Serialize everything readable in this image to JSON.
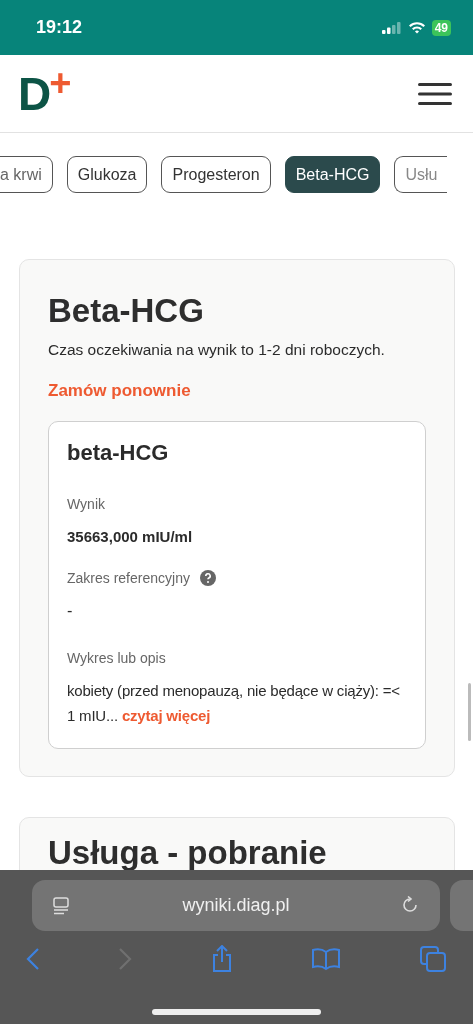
{
  "status_bar": {
    "time": "19:12",
    "battery": "49"
  },
  "header": {
    "logo_letter": "D",
    "logo_mark": "+"
  },
  "chips": [
    {
      "label": "a krwi",
      "selected": false
    },
    {
      "label": "Glukoza",
      "selected": false
    },
    {
      "label": "Progesteron",
      "selected": false
    },
    {
      "label": "Beta-HCG",
      "selected": true
    },
    {
      "label": "Usłu",
      "selected": false
    }
  ],
  "test_card": {
    "title": "Beta-HCG",
    "wait_note": "Czas oczekiwania na wynik to 1-2 dni roboczych.",
    "reorder_link": "Zamów ponownie",
    "result": {
      "name": "beta-HCG",
      "result_label": "Wynik",
      "result_value": "35663,000 mIU/ml",
      "range_label": "Zakres referencyjny",
      "range_value": "-",
      "description_label": "Wykres lub opis",
      "description": "kobiety (przed menopauzą, nie będące w ciąży): =< 1 mIU...",
      "read_more": "czytaj więcej"
    }
  },
  "next_card": {
    "title": "Usługa - pobranie"
  },
  "browser": {
    "url": "wyniki.diag.pl"
  }
}
